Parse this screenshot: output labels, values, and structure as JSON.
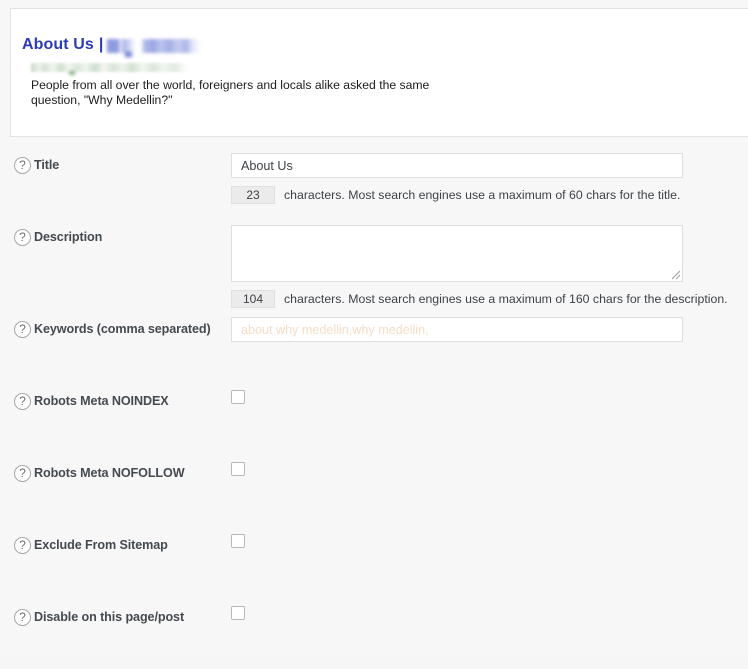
{
  "preview": {
    "title_text": "About Us",
    "title_separator": "|",
    "description": "People from all over the world, foreigners and locals alike asked the same question, \"Why Medellin?\""
  },
  "form": {
    "title_row": {
      "label": "Title",
      "help_icon": "question-mark-icon",
      "value": "About Us",
      "placeholder": "",
      "counter_value": "23",
      "counter_text": "characters. Most search engines use a maximum of 60 chars for the title."
    },
    "description_row": {
      "label": "Description",
      "help_icon": "question-mark-icon",
      "value": "",
      "placeholder": "",
      "counter_value": "104",
      "counter_text": "characters. Most search engines use a maximum of 160 chars for the description."
    },
    "keywords_row": {
      "label": "Keywords (comma separated)",
      "help_icon": "question-mark-icon",
      "value": "",
      "placeholder": "about why medellin,why medellin,"
    },
    "checkboxes": [
      {
        "label": "Robots Meta NOINDEX",
        "help_icon": "question-mark-icon",
        "checked": false
      },
      {
        "label": "Robots Meta NOFOLLOW",
        "help_icon": "question-mark-icon",
        "checked": false
      },
      {
        "label": "Exclude From Sitemap",
        "help_icon": "question-mark-icon",
        "checked": false
      },
      {
        "label": "Disable on this page/post",
        "help_icon": "question-mark-icon",
        "checked": false
      }
    ]
  },
  "icons": {
    "help": "?"
  },
  "colors": {
    "serp_title": "#2c3cb5",
    "label": "#444a50",
    "placeholder_keywords": "#f6ddc6",
    "counter_bg": "#ebebeb",
    "panel_border": "#e3e3e3"
  }
}
